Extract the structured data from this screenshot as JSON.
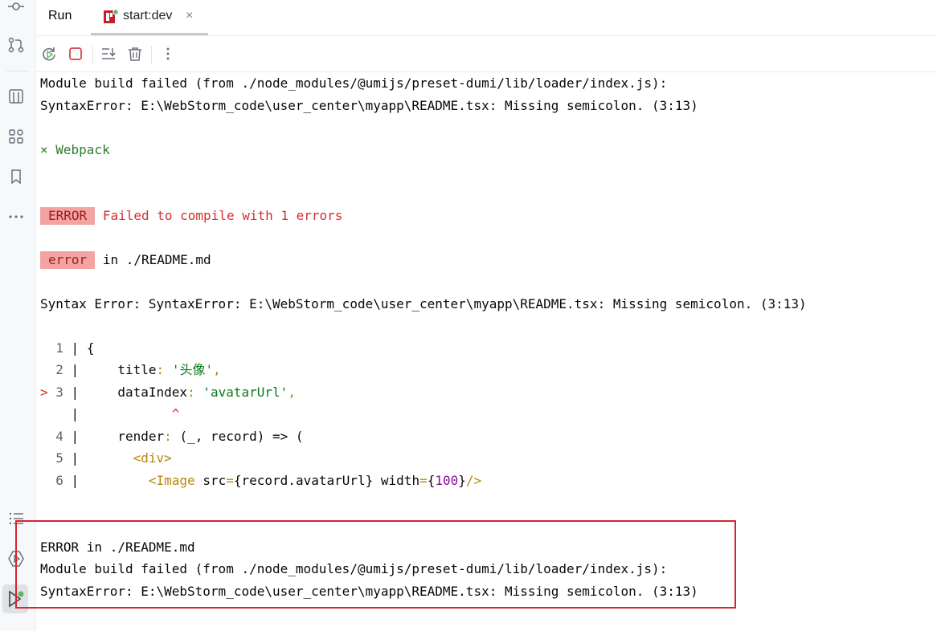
{
  "tabs": {
    "run_label": "Run",
    "start_label": "start:dev",
    "close_glyph": "×"
  },
  "sidebar": {
    "icons": [
      "commit-icon",
      "pull-request-icon",
      "structure-icon",
      "plugins-icon",
      "bookmark-icon",
      "more-icon",
      "todo-list-icon",
      "services-icon",
      "run-icon"
    ]
  },
  "toolbar": {
    "buttons": [
      "rerun-icon",
      "stop-icon",
      "scroll-to-end-icon",
      "clear-icon",
      "more-vertical-icon"
    ]
  },
  "console": {
    "line1": "Module build failed (from ./node_modules/@umijs/preset-dumi/lib/loader/index.js):",
    "line2": "SyntaxError: E:\\WebStorm_code\\user_center\\myapp\\README.tsx: Missing semicolon. (3:13)",
    "webpack": "× Webpack",
    "error_badge": "ERROR",
    "error_msg": "Failed to compile with 1 errors",
    "error_small_badge": "error",
    "error_in": "in ./README.md",
    "syntax_error": "Syntax Error: SyntaxError: E:\\WebStorm_code\\user_center\\myapp\\README.tsx: Missing semicolon. (3:13)",
    "code": [
      {
        "marker": " ",
        "num": "1",
        "text": "{"
      },
      {
        "marker": " ",
        "num": "2",
        "key": "title",
        "value": "'头像'"
      },
      {
        "marker": ">",
        "num": "3",
        "key": "dataIndex",
        "value": "'avatarUrl'"
      },
      {
        "marker": " ",
        "num": "",
        "caret": "^"
      },
      {
        "marker": " ",
        "num": "4",
        "key": "render",
        "rest": "(_, record) => ("
      },
      {
        "marker": " ",
        "num": "5",
        "tag": "<div>"
      },
      {
        "marker": " ",
        "num": "6",
        "img_open": "<Image",
        "src_attr": "src",
        "src_val": "{record.avatarUrl}",
        "width_attr": "width",
        "width_val": "100",
        "img_close": "/>"
      }
    ],
    "box_line1": "ERROR in ./README.md",
    "box_line2": "Module build failed (from ./node_modules/@umijs/preset-dumi/lib/loader/index.js):",
    "box_line3": "SyntaxError: E:\\WebStorm_code\\user_center\\myapp\\README.tsx: Missing semicolon. (3:13)"
  },
  "colors": {
    "error_border": "#d9232e",
    "badge_bg": "#f4a3a3",
    "green": "#2e7d32",
    "red": "#d32f2f"
  }
}
